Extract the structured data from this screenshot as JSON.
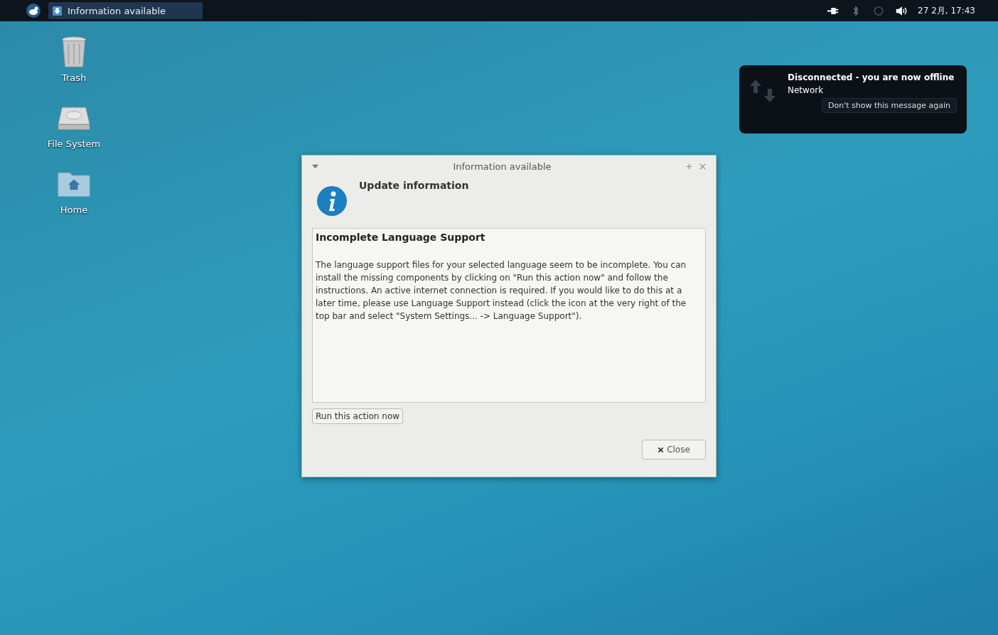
{
  "panel": {
    "taskbar_items": [
      {
        "label": "Information available",
        "selected": true
      }
    ],
    "clock": "27 2月, 17:43"
  },
  "desktop_icons": [
    {
      "label": "Trash",
      "kind": "trash"
    },
    {
      "label": "File System",
      "kind": "drive"
    },
    {
      "label": "Home",
      "kind": "home"
    }
  ],
  "notification": {
    "title": "Disconnected - you are now offline",
    "subtitle": "Network",
    "button": "Don't show this message again"
  },
  "dialog": {
    "title": "Information available",
    "heading": "Update information",
    "message_title": "Incomplete Language Support",
    "message": "The language support files for your selected language seem to be incomplete. You can install the missing components by clicking on \"Run this action now\" and follow the instructions. An active internet connection is required. If you would like to do this at a later time, please use Language Support instead (click the icon at the very right of the top bar and select \"System Settings... -> Language Support\").",
    "action_button": "Run this action now",
    "close_button": "Close"
  }
}
